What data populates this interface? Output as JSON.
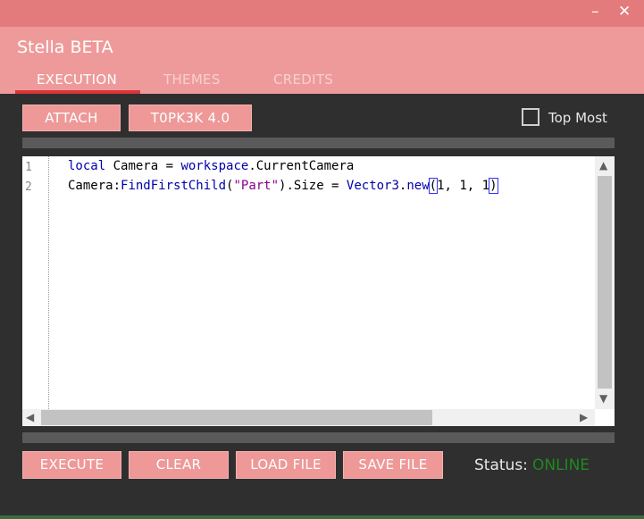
{
  "window": {
    "minimize_glyph": "–",
    "close_glyph": "✕"
  },
  "app": {
    "title": "Stella BETA"
  },
  "tabs": [
    {
      "label": "EXECUTION",
      "active": true
    },
    {
      "label": "THEMES",
      "active": false
    },
    {
      "label": "CREDITS",
      "active": false
    }
  ],
  "toolbar": {
    "attach_label": "ATTACH",
    "topk3k_label": "T0PK3K 4.0",
    "topmost_label": "Top Most",
    "topmost_checked": false
  },
  "editor": {
    "line_numbers": [
      "1",
      "2"
    ],
    "lines": [
      "local Camera = workspace.CurrentCamera",
      "Camera:FindFirstChild(\"Part\").Size = Vector3.new(1, 1, 1)"
    ],
    "line1": {
      "t1": "local",
      "t2": " Camera = ",
      "t3": "workspace",
      "t4": ".CurrentCamera"
    },
    "line2": {
      "t1": "Camera:",
      "t2": "FindFirstChild",
      "t3": "(",
      "t4": "\"Part\"",
      "t5": ").Size = ",
      "t6": "Vector3",
      "t7": ".",
      "t8": "new",
      "t9": "(",
      "t10": "1, 1, 1",
      "t11": ")"
    }
  },
  "actions": {
    "execute_label": "EXECUTE",
    "clear_label": "CLEAR",
    "load_label": "LOAD FILE",
    "save_label": "SAVE FILE"
  },
  "status": {
    "label": "Status:",
    "value": "ONLINE",
    "color": "#1e8a1e"
  },
  "colors": {
    "titlebar": "#e37a7b",
    "header": "#ef9a9a",
    "accent_underline": "#d9363a",
    "button": "#ee9898",
    "background": "#2f2f2f"
  }
}
